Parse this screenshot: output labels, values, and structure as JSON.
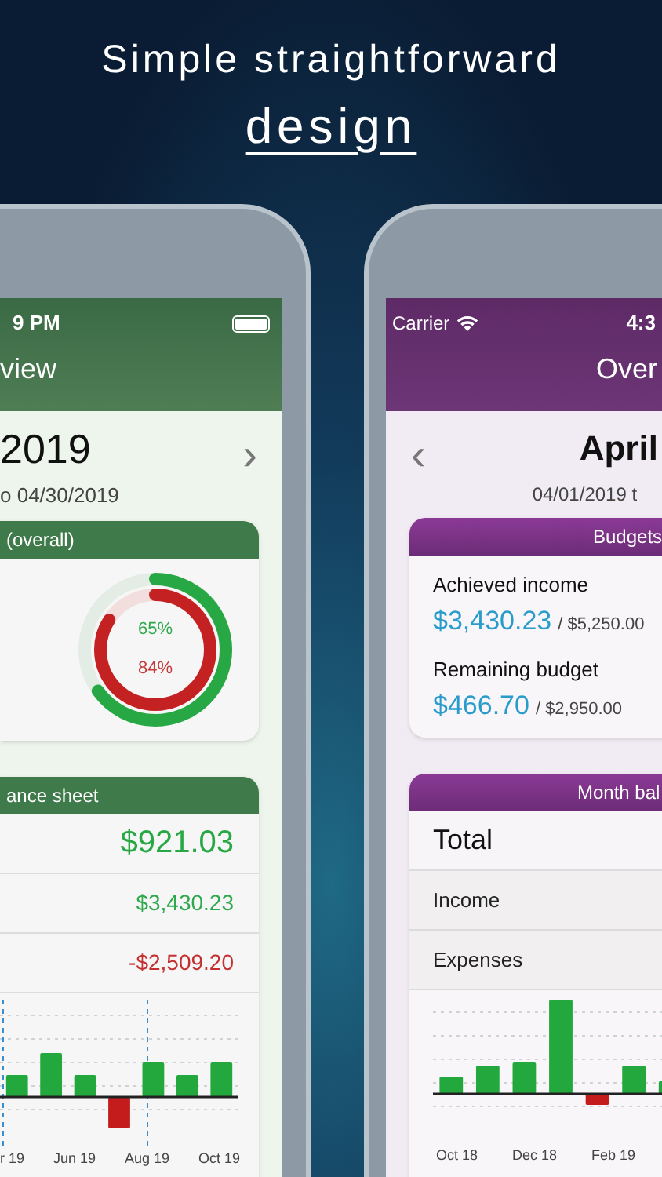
{
  "headline": {
    "line_1": "Simple straightforward",
    "line_2": "design"
  },
  "left_phone": {
    "next_glyph": "›",
    "status_time": "9 PM",
    "nav_title": "view",
    "period_title": "2019",
    "period_range": "o 04/30/2019",
    "budget_card": {
      "title": "(overall)",
      "rings": [
        {
          "label": "65%",
          "level": 0.65,
          "kind": "income"
        },
        {
          "label": "84%",
          "level": 0.84,
          "kind": "expense"
        }
      ]
    },
    "balance_card": {
      "title": "ance sheet",
      "rows": [
        {
          "value": "$921.03",
          "kind": "total"
        },
        {
          "value": "$3,430.23",
          "kind": "income"
        },
        {
          "value": "-$2,509.20",
          "kind": "expense"
        }
      ],
      "x_labels": [
        "r 19",
        "Jun 19",
        "Aug 19",
        "Oct 19"
      ]
    }
  },
  "right_phone": {
    "back_glyph": "‹",
    "carrier": "Carrier",
    "status_time": "4:3",
    "nav_title": "Over",
    "period_title": "April",
    "period_range": "04/01/2019 t",
    "budget_card": {
      "title": "Budgets",
      "items": [
        {
          "label": "Achieved income",
          "value": "$3,430.23",
          "total": "/ $5,250.00"
        },
        {
          "label": "Remaining budget",
          "value": "$466.70",
          "total": "/ $2,950.00"
        }
      ]
    },
    "balance_card": {
      "title": "Month bal",
      "rows": [
        {
          "label": "Total",
          "kind": "total"
        },
        {
          "label": "Income",
          "kind": "income"
        },
        {
          "label": "Expenses",
          "kind": "expense"
        }
      ],
      "x_labels": [
        "Oct 18",
        "Dec 18",
        "Feb 19"
      ]
    }
  }
}
